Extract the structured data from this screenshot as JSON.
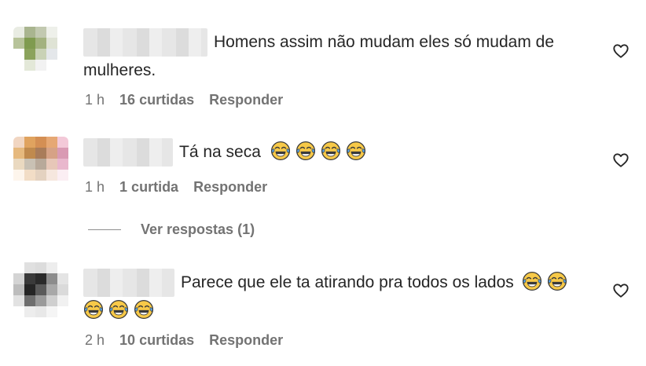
{
  "comments": [
    {
      "text": "Homens assim não mudam eles só mudam de mulheres.",
      "time": "1 h",
      "likes": "16 curtidas",
      "reply": "Responder",
      "emojis": []
    },
    {
      "text": "Tá na seca",
      "time": "1 h",
      "likes": "1 curtida",
      "reply": "Responder",
      "emojis": [
        "joy-emoji",
        "joy-emoji",
        "joy-emoji",
        "joy-emoji"
      ]
    },
    {
      "text": "Parece que ele ta atirando pra todos os lados",
      "time": "2 h",
      "likes": "10 curtidas",
      "reply": "Responder",
      "emojis": [
        "joy-emoji",
        "joy-emoji",
        "joy-emoji",
        "joy-emoji",
        "joy-emoji"
      ]
    }
  ],
  "view_replies": "Ver respostas (1)",
  "icons": {
    "like": "heart-outline-icon",
    "emoji": "face-with-tears-of-joy"
  },
  "colors": {
    "text": "#262626",
    "secondary": "#737373",
    "emoji_face": "#f7c948"
  }
}
